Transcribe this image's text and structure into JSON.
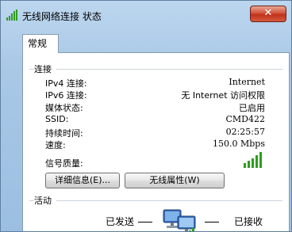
{
  "window": {
    "title": "无线网络连接 状态",
    "close_label": "✕"
  },
  "tabs": [
    {
      "label": "常规"
    }
  ],
  "connection": {
    "group_label": "连接",
    "rows": [
      {
        "label": "IPv4 连接:",
        "value": "Internet"
      },
      {
        "label": "IPv6 连接:",
        "value": "无 Internet 访问权限"
      },
      {
        "label": "媒体状态:",
        "value": "已启用"
      },
      {
        "label": "SSID:",
        "value": "CMD422"
      },
      {
        "label": "持续时间:",
        "value": "02:25:57"
      },
      {
        "label": "速度:",
        "value": "150.0 Mbps"
      }
    ],
    "signal_label": "信号质量:",
    "signal_bars": 5,
    "signal_color": "#2e9d1f"
  },
  "buttons": {
    "details": "详细信息(E)...",
    "wireless_properties": "无线属性(W)"
  },
  "activity": {
    "group_label": "活动",
    "sent_label": "已发送",
    "received_label": "已接收"
  }
}
